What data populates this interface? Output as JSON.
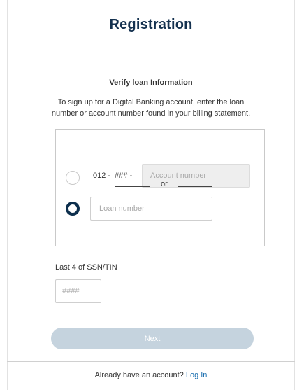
{
  "header": {
    "title": "Registration"
  },
  "verify": {
    "heading": "Verify loan Information",
    "instructions_line1": "To sign up for a Digital Banking account, enter the loan",
    "instructions_line2": "number or account number found in your billing statement."
  },
  "account_option": {
    "selected": false,
    "prefix": "012 -  ### -",
    "placeholder": "Account number",
    "value": ""
  },
  "separator": {
    "text": "or"
  },
  "loan_option": {
    "selected": true,
    "placeholder": "Loan number",
    "value": ""
  },
  "ssn": {
    "label": "Last 4 of SSN/TIN",
    "placeholder": "####",
    "value": ""
  },
  "actions": {
    "next_label": "Next",
    "next_enabled": false
  },
  "footer": {
    "prompt": "Already have an account?",
    "login_label": "Log In"
  },
  "colors": {
    "title": "#14314f",
    "radio_selected": "#0d2f4d",
    "button_disabled": "#c5d3de",
    "link": "#1a6fb0"
  }
}
